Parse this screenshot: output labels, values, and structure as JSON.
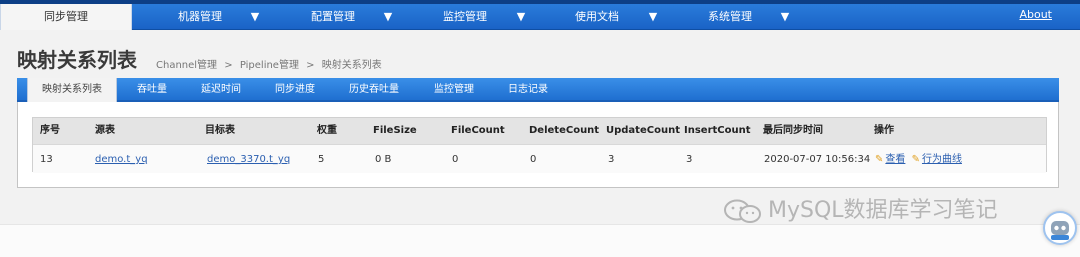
{
  "nav": {
    "items": [
      {
        "label": "同步管理"
      },
      {
        "label": "机器管理"
      },
      {
        "label": "配置管理"
      },
      {
        "label": "监控管理"
      },
      {
        "label": "使用文档"
      },
      {
        "label": "系统管理"
      }
    ],
    "about": "About",
    "caret_icon": "chevron-down-icon"
  },
  "header": {
    "title": "映射关系列表",
    "breadcrumb": [
      "Channel管理",
      ">",
      "Pipeline管理",
      ">",
      "映射关系列表"
    ]
  },
  "subtabs": [
    "映射关系列表",
    "吞吐量",
    "延迟时间",
    "同步进度",
    "历史吞吐量",
    "监控管理",
    "日志记录"
  ],
  "table": {
    "columns": [
      "序号",
      "源表",
      "目标表",
      "权重",
      "FileSize",
      "FileCount",
      "DeleteCount",
      "UpdateCount",
      "InsertCount",
      "最后同步时间",
      "操作"
    ],
    "rows": [
      {
        "id": "13",
        "source": "demo.t_yq",
        "target": "demo_3370.t_yq",
        "weight": "5",
        "filesize": "0 B",
        "filecount": "0",
        "deletecount": "0",
        "updatecount": "3",
        "insertcount": "3",
        "last_sync": "2020-07-07 10:56:34",
        "actions": [
          "查看",
          "行为曲线"
        ]
      }
    ]
  },
  "watermark": "MySQL数据库学习笔记",
  "colors": {
    "nav_blue": "#1a63c6",
    "link": "#2b5fb0",
    "pencil": "#e0a020"
  }
}
